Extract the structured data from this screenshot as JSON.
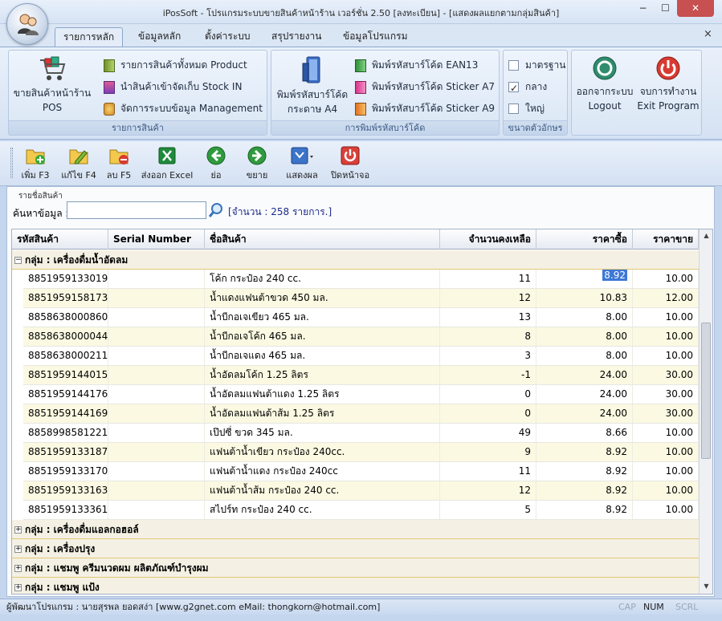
{
  "window": {
    "title": "iPosSoft - โปรแกรมระบบขายสินค้าหน้าร้าน เวอร์ชั่น 2.50 [ลงทะเบียน] - [แสดงผลแยกตามกลุ่มสินค้า]",
    "minimize": "−",
    "maximize": "☐",
    "close": "✕"
  },
  "ribbon_tabs": [
    "รายการหลัก",
    "ข้อมูลหลัก",
    "ตั้งค่าระบบ",
    "สรุปรายงาน",
    "ข้อมูลโปรแกรม"
  ],
  "ribbon_close": "×",
  "ribbon": {
    "pos_button": {
      "line1": "ขายสินค้าหน้าร้าน",
      "line2": "POS"
    },
    "products_group": {
      "label": "รายการสินค้า",
      "items": [
        "รายการสินค้าทั้งหมด Product",
        "นำสินค้าเข้าจัดเก็บ Stock IN",
        "จัดการระบบข้อมูล Management"
      ]
    },
    "barcode_group": {
      "label": "การพิมพ์รหัสบาร์โค้ด",
      "big": {
        "line1": "พิมพ์รหัสบาร์โค้ด",
        "line2": "กระดาษ A4"
      },
      "items": [
        "พิมพ์รหัสบาร์โค้ด EAN13",
        "พิมพ์รหัสบาร์โค้ด Sticker A7",
        "พิมพ์รหัสบาร์โค้ด Sticker A9"
      ]
    },
    "fontsize_group": {
      "label": "ขนาดตัวอักษร",
      "options": [
        {
          "label": "มาตรฐาน",
          "checked": false
        },
        {
          "label": "กลาง",
          "checked": true
        },
        {
          "label": "ใหญ่",
          "checked": false
        }
      ]
    },
    "logout": {
      "line1": "ออกจากระบบ",
      "line2": "Logout"
    },
    "exit": {
      "line1": "จบการทำงาน",
      "line2": "Exit Program"
    }
  },
  "toolbar": {
    "add": "เพิ่ม F3",
    "edit": "แก้ไข F4",
    "delete": "ลบ F5",
    "export": "ส่งออก Excel",
    "collapse": "ย่อ",
    "expand": "ขยาย",
    "view": "แสดงผล",
    "close": "ปิดหน้าจอ"
  },
  "search": {
    "caption": "รายชื่อสินค้า",
    "label": "ค้นหาข้อมูล :",
    "value": "",
    "placeholder": "",
    "count": "[จำนวน : 258 รายการ.]"
  },
  "columns": [
    "รหัสสินค้า",
    "Serial Number",
    "ชื่อสินค้า",
    "จำนวนคงเหลือ",
    "ราคาซื้อ",
    "ราคาขาย"
  ],
  "open_group": {
    "label": "กลุ่ม : เครื่องดื่มน้ำอัดลม",
    "toggle": "−"
  },
  "rows": [
    {
      "code": "8851959133019",
      "serial": "",
      "name": "โค้ก กระป๋อง 240 cc.",
      "qty": "11",
      "cost": "8.92",
      "price": "10.00"
    },
    {
      "code": "8851959158173",
      "serial": "",
      "name": "น้ำแดงแฟนต้าขวด 450 มล.",
      "qty": "12",
      "cost": "10.83",
      "price": "12.00"
    },
    {
      "code": "8858638000860",
      "serial": "",
      "name": "น้ำบีกอเจเขียว  465 มล.",
      "qty": "13",
      "cost": "8.00",
      "price": "10.00"
    },
    {
      "code": "8858638000044",
      "serial": "",
      "name": "น้ำบีกอเจโค้ก 465 มล.",
      "qty": "8",
      "cost": "8.00",
      "price": "10.00"
    },
    {
      "code": "8858638000211",
      "serial": "",
      "name": "น้ำบีกอเจแดง 465 มล.",
      "qty": "3",
      "cost": "8.00",
      "price": "10.00"
    },
    {
      "code": "8851959144015",
      "serial": "",
      "name": "น้ำอัดลมโค้ก 1.25 ลิตร",
      "qty": "-1",
      "cost": "24.00",
      "price": "30.00"
    },
    {
      "code": "8851959144176",
      "serial": "",
      "name": "น้ำอัดลมแฟนต้าแดง 1.25 ลิตร",
      "qty": "0",
      "cost": "24.00",
      "price": "30.00"
    },
    {
      "code": "8851959144169",
      "serial": "",
      "name": "น้ำอัดลมแฟนต้าส้ม 1.25 ลิตร",
      "qty": "0",
      "cost": "24.00",
      "price": "30.00"
    },
    {
      "code": "8858998581221",
      "serial": "",
      "name": "เป๊ปซี่ ขวด 345 มล.",
      "qty": "49",
      "cost": "8.66",
      "price": "10.00"
    },
    {
      "code": "8851959133187",
      "serial": "",
      "name": "แฟนต้าน้ำเขียว กระป๋อง 240cc.",
      "qty": "9",
      "cost": "8.92",
      "price": "10.00"
    },
    {
      "code": "8851959133170",
      "serial": "",
      "name": "แฟนต้าน้ำแดง กระป๋อง 240cc",
      "qty": "11",
      "cost": "8.92",
      "price": "10.00"
    },
    {
      "code": "8851959133163",
      "serial": "",
      "name": "แฟนต้าน้ำส้ม กระป๋อง 240 cc.",
      "qty": "12",
      "cost": "8.92",
      "price": "10.00"
    },
    {
      "code": "8851959133361",
      "serial": "",
      "name": "สไปร์ท กระป๋อง 240 cc.",
      "qty": "5",
      "cost": "8.92",
      "price": "10.00"
    }
  ],
  "collapsed_groups": [
    {
      "label": "กลุ่ม : เครื่องดื่มแอลกอฮอล์",
      "toggle": "+"
    },
    {
      "label": "กลุ่ม : เครื่องปรุง",
      "toggle": "+"
    },
    {
      "label": "กลุ่ม : แชมพู ครีมนวดผม ผลิตภัณฑ์บำรุงผม",
      "toggle": "+"
    },
    {
      "label": "กลุ่ม : แชมพู แป้ง",
      "toggle": "+"
    }
  ],
  "statusbar": {
    "text": "ผู้พัฒนาโปรแกรม : นายสุรพล ยอดสง่า [www.g2gnet.com  eMail: thongkorn@hotmail.com]",
    "cap": "CAP",
    "num": "NUM",
    "scrl": "SCRL"
  },
  "colors": {
    "selection": "#3d78d8",
    "alt_row": "#fbf9e2",
    "accent_link": "#1c2a8c"
  },
  "icons": [
    "app-users-icon",
    "cart-icon",
    "book-icon",
    "box-in-icon",
    "gear-manage-icon",
    "barcode-big-icon",
    "barcode-green-icon",
    "barcode-pink-icon",
    "barcode-orange-icon",
    "logout-icon",
    "power-icon",
    "add-folder-icon",
    "edit-pencil-icon",
    "delete-folder-icon",
    "excel-icon",
    "left-arrow-icon",
    "right-arrow-icon",
    "view-icon",
    "close-power-icon",
    "search-icon"
  ]
}
